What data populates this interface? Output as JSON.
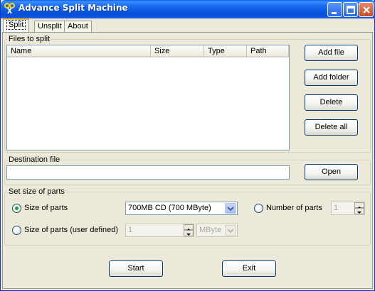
{
  "window": {
    "title": "Advance Split Machine"
  },
  "tabs": [
    {
      "label": "Split",
      "active": true
    },
    {
      "label": "Unsplit",
      "active": false
    },
    {
      "label": "About",
      "active": false
    }
  ],
  "files_group": {
    "label": "Files to split",
    "columns": [
      "Name",
      "Size",
      "Type",
      "Path"
    ],
    "rows": [],
    "buttons": {
      "add_file": "Add file",
      "add_folder": "Add folder",
      "delete": "Delete",
      "delete_all": "Delete all"
    }
  },
  "destination_group": {
    "label": "Destination file",
    "value": "",
    "open_label": "Open"
  },
  "size_group": {
    "label": "Set size of parts",
    "size_of_parts_label": "Size of parts",
    "size_of_parts_selected": true,
    "size_preset": "700MB CD (700 MByte)",
    "number_of_parts_label": "Number of parts",
    "number_of_parts_value": "1",
    "user_defined_label": "Size of parts (user defined)",
    "user_defined_value": "1",
    "unit": "MByte"
  },
  "actions": {
    "start_label": "Start",
    "exit_label": "Exit"
  },
  "icons": {
    "app": "scissors-icon",
    "minimize": "minimize-icon",
    "maximize": "maximize-icon",
    "close": "close-icon"
  },
  "colors": {
    "titlebar": "#0b57e0",
    "window_bg": "#ece9d8",
    "active_tab_accent": "#ffc83c",
    "radio_selected": "#21a121"
  }
}
